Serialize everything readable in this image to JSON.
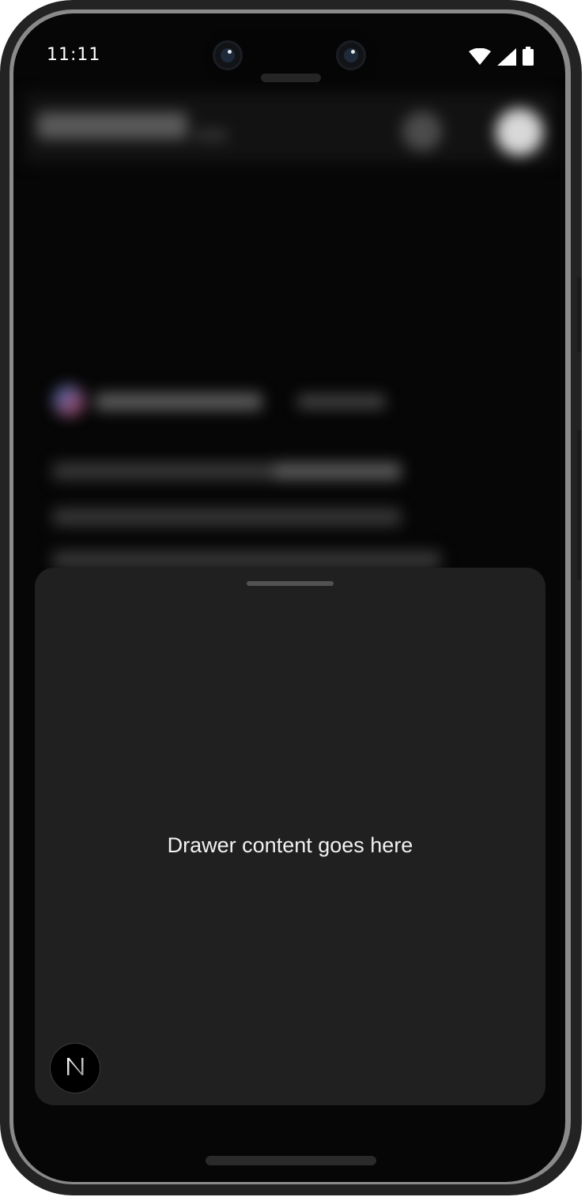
{
  "status_bar": {
    "time": "11:11",
    "icons": [
      "wifi-icon",
      "cellular-signal-icon",
      "battery-icon"
    ]
  },
  "drawer": {
    "content_text": "Drawer content goes here"
  },
  "badge": {
    "letter": "N",
    "icon": "next-logo-icon"
  },
  "colors": {
    "screen_background": "#060606",
    "drawer_background": "#202020",
    "handle": "#525252",
    "text": "#f2f2f2"
  }
}
